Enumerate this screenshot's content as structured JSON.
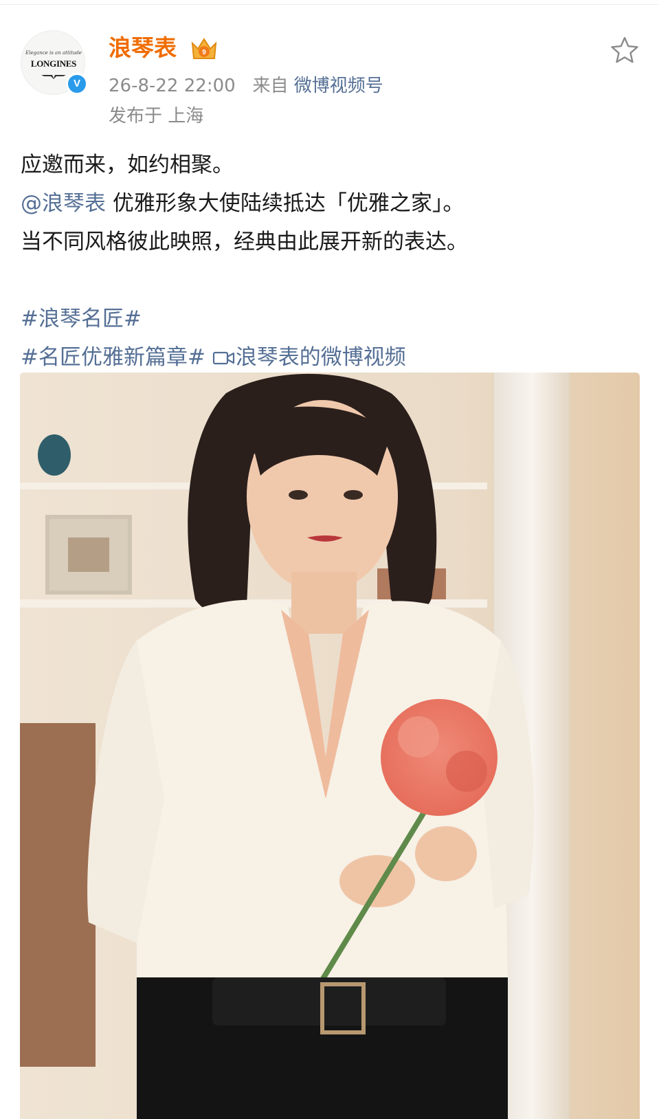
{
  "post": {
    "username": "浪琴表",
    "avatar_script": "Elegance is an attitude",
    "avatar_brand": "LONGINES",
    "verified_mark": "V",
    "timestamp": "26-8-22 22:00",
    "source_prefix": "来自",
    "source": "微博视频号",
    "location": "发布于 上海",
    "body": {
      "line1": "应邀而来，如约相聚。",
      "mention": "@浪琴表",
      "line2_rest": " 优雅形象大使陆续抵达「优雅之家」。",
      "line3": "当不同风格彼此映照，经典由此展开新的表达。",
      "hashtag1": "#浪琴名匠#",
      "hashtag2": "#名匠优雅新篇章#",
      "video_link": "浪琴表的微博视频"
    }
  },
  "icons": {
    "favorite": "star-outline-icon",
    "badge": "crown-badge-icon",
    "video": "video-camera-icon"
  },
  "colors": {
    "username": "#f06c00",
    "link": "#556f95",
    "meta": "#8b8b8b",
    "verified": "#2a9bea"
  }
}
